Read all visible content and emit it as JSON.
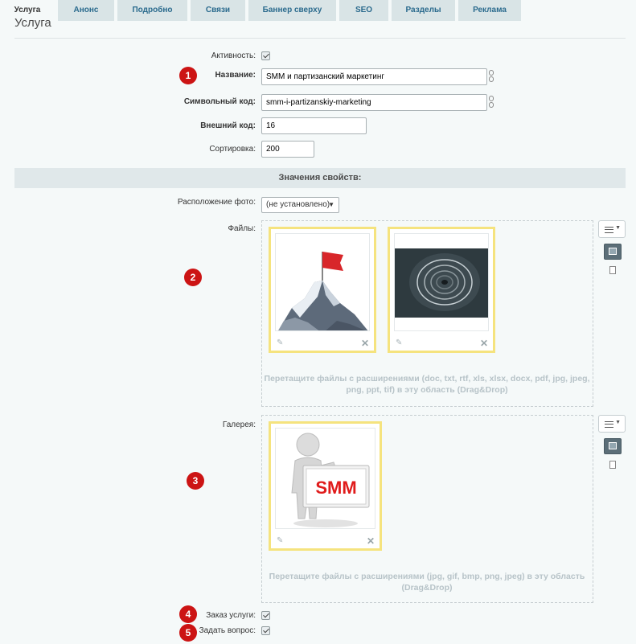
{
  "tabs": [
    "Услуга",
    "Анонс",
    "Подробно",
    "Связи",
    "Баннер сверху",
    "SEO",
    "Разделы",
    "Реклама"
  ],
  "section_title": "Услуга",
  "form": {
    "active_label": "Активность:",
    "active_checked": true,
    "name_label": "Название:",
    "name_value": "SMM и партизанский маркетинг",
    "code_label": "Символьный код:",
    "code_value": "smm-i-partizanskiy-marketing",
    "ext_label": "Внешний код:",
    "ext_value": "16",
    "sort_label": "Сортировка:",
    "sort_value": "200"
  },
  "properties": {
    "header": "Значения свойств:",
    "photo_label": "Расположение фото:",
    "photo_value": "(не установлено)",
    "files_label": "Файлы:",
    "files_hint": "Перетащите файлы с расширениями (doc, txt, rtf, xls, xlsx, docx, pdf, jpg, jpeg, png, ppt, tif) в эту область (Drag&Drop)",
    "gallery_label": "Галерея:",
    "gallery_hint": "Перетащите файлы с расширениями (jpg, gif, bmp, png, jpeg) в эту область (Drag&Drop)",
    "gallery_card_text": "SMM",
    "order_label": "Заказ услуги:",
    "order_checked": true,
    "question_label": "Задать вопрос:",
    "question_checked": true
  },
  "badges": [
    "1",
    "2",
    "3",
    "4",
    "5"
  ],
  "icons": {
    "file_edit": "pencil-icon",
    "file_remove": "close-icon",
    "menu": "menu-icon",
    "image_view": "image-icon",
    "doc_view": "document-icon",
    "link": "link-icon"
  },
  "colors": {
    "badge": "#cc1414",
    "card_border": "#f5e37e",
    "tab_text": "#2a6a8d",
    "band": "#e0e8ea"
  }
}
